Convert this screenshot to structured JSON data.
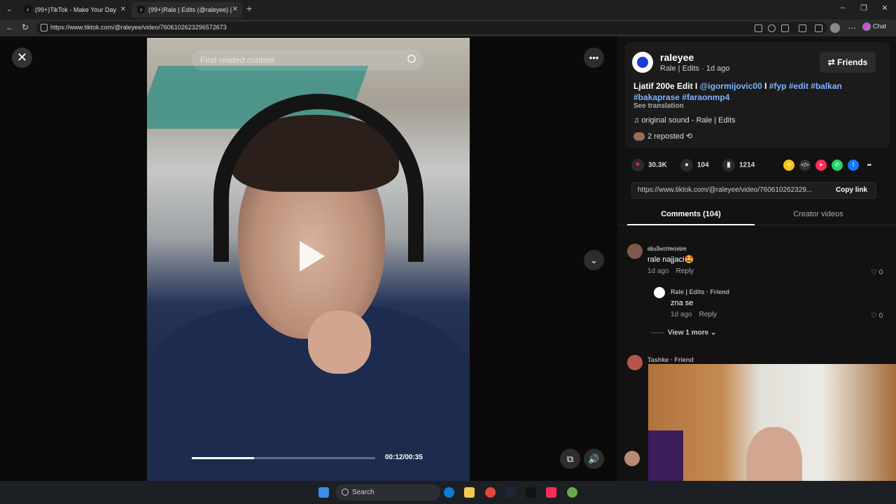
{
  "browser": {
    "tabs": [
      {
        "label": "(99+)TikTok - Make Your Day",
        "active": false
      },
      {
        "label": "(99+)Rale | Edits (@raleyee) |",
        "active": true
      }
    ],
    "url": "https://www.tiktok.com/@raleyee/video/7606102623296572673",
    "chat_label": "Chat"
  },
  "video": {
    "search_placeholder": "Find related content",
    "time": "00:12/00:35",
    "progress": 0.34
  },
  "post": {
    "username": "raleyee",
    "author_sub": "Rale | Edits · 1d ago",
    "friends_label": "Friends",
    "caption_text": "Ljatif 200e Edit I ",
    "caption_mention": "@igormijovic00",
    "caption_sep": " I ",
    "caption_tags": [
      "#fyp",
      "#edit",
      "#balkan",
      "#bakaprase",
      "#faraonmp4"
    ],
    "see_translation": "See translation",
    "sound": "original sound - Rale | Edits",
    "reposted": "2 reposted",
    "likes": "30.3K",
    "comments_count": "104",
    "saves": "1214",
    "share_url": "https://www.tiktok.com/@raleyee/video/760610262329...",
    "copy_link_label": "Copy link",
    "colors": {
      "like": "#fe2c55",
      "tag": "#7fb3ff"
    }
  },
  "tabs": {
    "comments": "Comments (104)",
    "creator": "Creator videos"
  },
  "comments": [
    {
      "name": "𝔞𝔨𝔲𝔩𝔟𝔢𝔯𝔯𝔦𝔳𝔢𝔯𝔰𝔦𝔬𝔫",
      "text": "rale najjaci🤩",
      "meta": "1d ago",
      "reply": "Reply",
      "likes": "0"
    },
    {
      "name": "Rale | Edits · Friend",
      "text": "zna se",
      "meta": "1d ago",
      "reply": "Reply",
      "likes": "0"
    }
  ],
  "view_more": "View 1 more",
  "comment3_name": "Tashke · Friend",
  "taskbar": {
    "search_label": "Search"
  }
}
